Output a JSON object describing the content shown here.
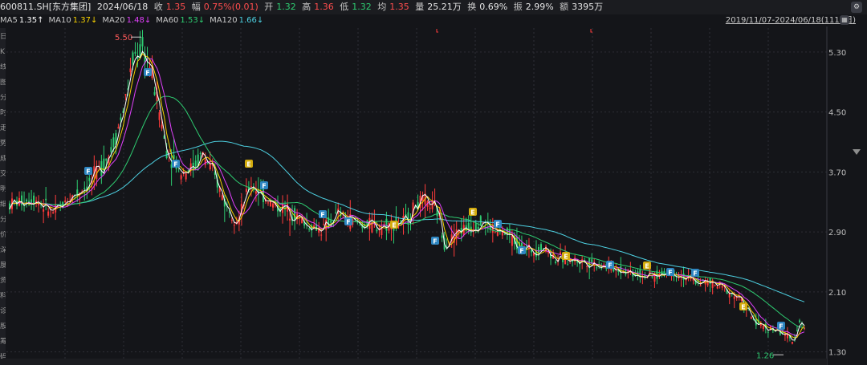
{
  "header": {
    "code": "600811.SH[东方集团]",
    "date": "2024/06/18",
    "close_label": "收",
    "close": "1.35",
    "amp_label": "幅",
    "amp": "0.75%(0.01)",
    "open_label": "开",
    "open": "1.32",
    "high_label": "高",
    "high": "1.36",
    "low_label": "低",
    "low": "1.32",
    "avg_label": "均",
    "avg": "1.35",
    "vol_label": "量",
    "vol": "25.21万",
    "turnover_label": "换",
    "turnover": "0.69%",
    "swing_label": "振",
    "swing": "2.99%",
    "amount_label": "额",
    "amount": "3395万"
  },
  "ma_legend": [
    {
      "name": "MA5",
      "value": "1.35",
      "arrow": "↑",
      "color": "#ffffff"
    },
    {
      "name": "MA10",
      "value": "1.37",
      "arrow": "↓",
      "color": "#f5d000"
    },
    {
      "name": "MA20",
      "value": "1.48",
      "arrow": "↓",
      "color": "#e040fb"
    },
    {
      "name": "MA60",
      "value": "1.53",
      "arrow": "↓",
      "color": "#2ecc71"
    },
    {
      "name": "MA120",
      "value": "1.66",
      "arrow": "↓",
      "color": "#4dd0e1"
    }
  ],
  "range_label": "2019/11/07-2024/06/18(1118日)",
  "sidebar_chars": [
    "日",
    "K",
    "线",
    "图",
    "分",
    "时",
    "走",
    "势",
    "成",
    "交",
    "明",
    "细",
    "分",
    "价",
    "深",
    "度",
    "资",
    "料",
    "诊",
    "股",
    "筹",
    "码"
  ],
  "chart_data": {
    "type": "candlestick",
    "y_ticks": [
      "5.30",
      "4.50",
      "3.70",
      "2.90",
      "2.10",
      "1.30"
    ],
    "ylim": [
      1.21,
      5.62
    ],
    "x_range": [
      "2019/11/07",
      "2024/06/18"
    ],
    "trading_days": 1118,
    "max_label": "5.50",
    "min_label": "1.26",
    "colors": {
      "up": "#ff3b3b",
      "down": "#2ecc71",
      "ma5": "#ffffff",
      "ma10": "#f5d000",
      "ma20": "#e040fb",
      "ma60": "#2ecc71",
      "ma120": "#4dd0e1",
      "grid": "#2e2f36"
    },
    "marker_F": "F",
    "marker_E": "E"
  }
}
